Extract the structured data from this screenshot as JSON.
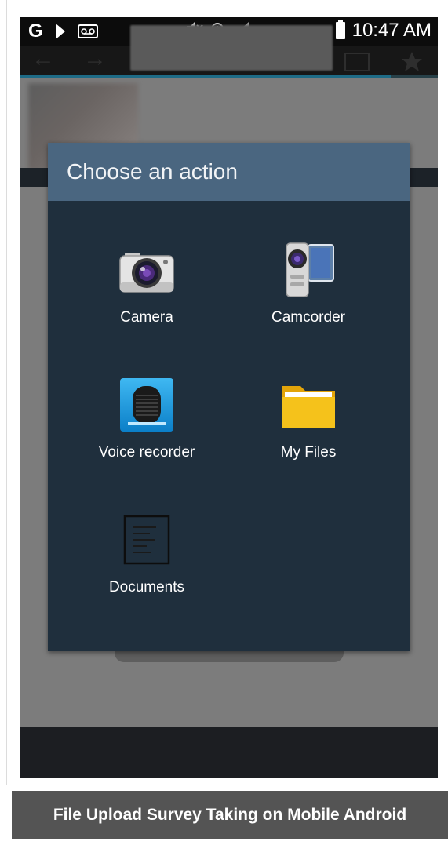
{
  "status_bar": {
    "time": "10:47 AM",
    "carrier_icon": "G",
    "icons": [
      "google-icon",
      "play-icon",
      "voicemail-icon",
      "mute-icon",
      "alarm-icon",
      "signal-icon",
      "battery-icon"
    ]
  },
  "dialog": {
    "title": "Choose an action",
    "actions": [
      {
        "label": "Camera",
        "icon": "camera-icon"
      },
      {
        "label": "Camcorder",
        "icon": "camcorder-icon"
      },
      {
        "label": "Voice recorder",
        "icon": "voice-recorder-icon"
      },
      {
        "label": "My Files",
        "icon": "folder-icon"
      },
      {
        "label": "Documents",
        "icon": "document-icon"
      }
    ]
  },
  "caption": {
    "text": "File Upload Survey Taking on Mobile Android"
  },
  "colors": {
    "dialog_header": "#4a6680",
    "dialog_body": "#1f2f3d",
    "caption_bg": "#545454",
    "folder_yellow": "#f5c21b",
    "recorder_blue": "#1aa3e8"
  }
}
